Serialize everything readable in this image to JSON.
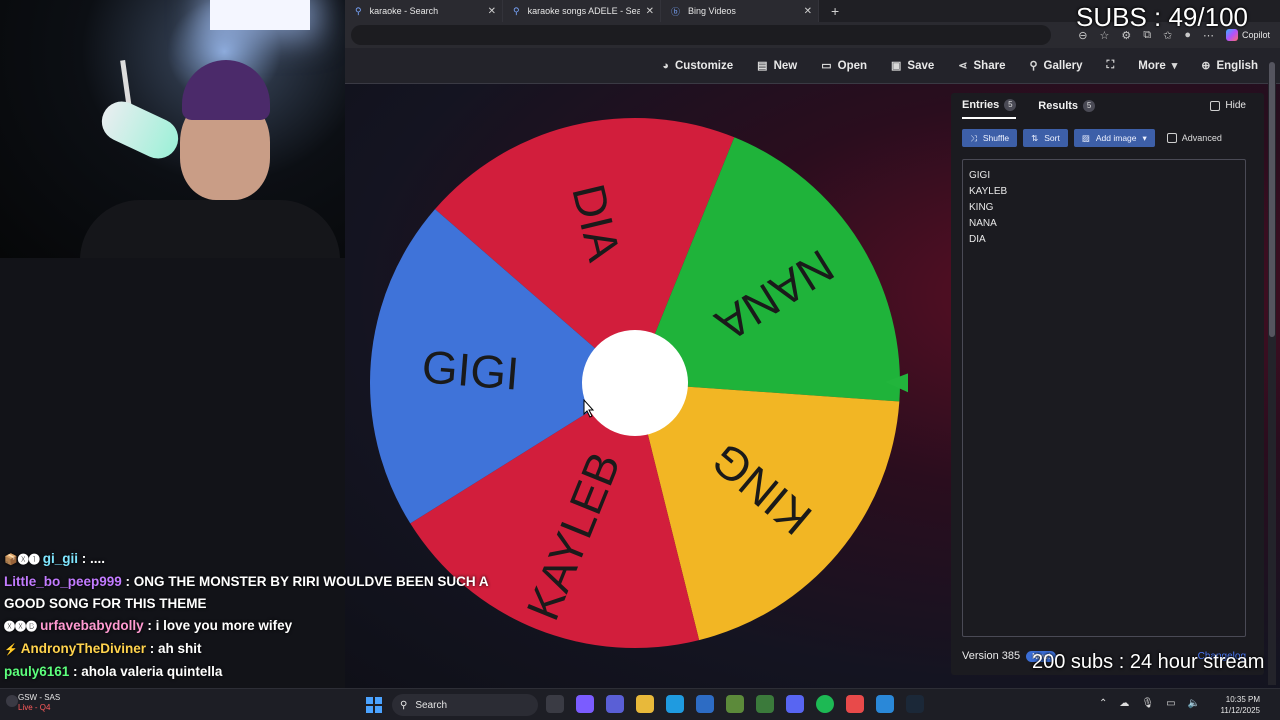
{
  "browser": {
    "tabs": [
      {
        "title": "karaoke - Search"
      },
      {
        "title": "karaoke songs ADELE - Search"
      },
      {
        "title": "Bing Videos"
      }
    ],
    "new_tab": "+",
    "copilot_label": "Copilot"
  },
  "header": {
    "items": [
      {
        "label": "Customize",
        "icon": "palette-icon"
      },
      {
        "label": "New",
        "icon": "file-icon"
      },
      {
        "label": "Open",
        "icon": "folder-icon"
      },
      {
        "label": "Save",
        "icon": "save-icon"
      },
      {
        "label": "Share",
        "icon": "share-icon"
      },
      {
        "label": "Gallery",
        "icon": "search-icon"
      },
      {
        "label": "",
        "icon": "fullscreen-icon"
      },
      {
        "label": "More",
        "icon": "chevron-down-icon"
      },
      {
        "label": "English",
        "icon": "globe-icon"
      }
    ]
  },
  "wheel": {
    "sectors": [
      {
        "label": "DIA",
        "color": "#d21e3c"
      },
      {
        "label": "NANA",
        "color": "#1fb33a"
      },
      {
        "label": "KING",
        "color": "#f2b624"
      },
      {
        "label": "KAYLEB",
        "color": "#d21e3c"
      },
      {
        "label": "GIGI",
        "color": "#3f73d9"
      }
    ],
    "pointer_color": "#22b53c",
    "center_color": "#ffffff"
  },
  "panel": {
    "tabs": [
      {
        "label": "Entries",
        "count": "5"
      },
      {
        "label": "Results",
        "count": "5"
      }
    ],
    "hide_label": "Hide",
    "buttons": {
      "shuffle": "Shuffle",
      "sort": "Sort",
      "add_image": "Add image"
    },
    "advanced_label": "Advanced",
    "entries": [
      "GIGI",
      "KAYLEB",
      "KING",
      "NANA",
      "DIA"
    ],
    "version": "Version 385",
    "new_badge": "New!",
    "changelog": "Changelog"
  },
  "overlay": {
    "subs": "SUBS : 49/100",
    "stream": "200 subs : 24 hour stream"
  },
  "chat": [
    {
      "badges": "📦🅧❶",
      "user": "gi_gii",
      "user_color": "#7fe6ff",
      "message": " : ...."
    },
    {
      "badges": "",
      "user": "Little_bo_peep999",
      "user_color": "#c27bff",
      "message": " : ONG THE MONSTER BY RIRI WOULDVE BEEN SUCH A GOOD SONG FOR THIS THEME"
    },
    {
      "badges": "🅧🅧🅑",
      "user": "urfavebabydolly",
      "user_color": "#ff9ad1",
      "message": " : i love you more wifey"
    },
    {
      "badges": "⚡",
      "user": "AndronyTheDiviner",
      "user_color": "#ffd34d",
      "message": " : ah shit"
    },
    {
      "badges": "",
      "user": "pauly6161",
      "user_color": "#5dff7d",
      "message": " : ahola valeria quintella"
    }
  ],
  "taskbar": {
    "weather_title": "GSW - SAS",
    "weather_sub": "Live - Q4",
    "search": "Search",
    "time": "10:35 PM",
    "date": "11/12/2025"
  }
}
